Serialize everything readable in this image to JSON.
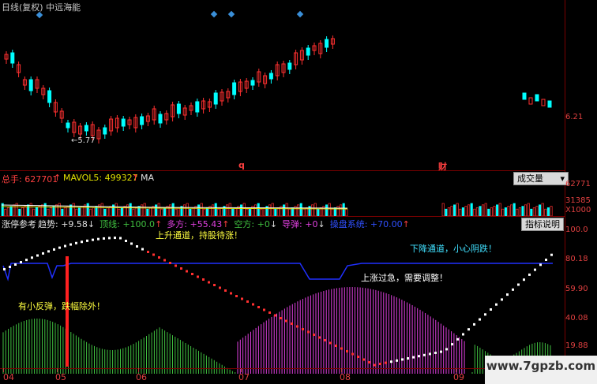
{
  "header": {
    "title": "日线(复权) 中远海能"
  },
  "price_panel": {
    "axis_label": "6.21",
    "low_marker": "5.77",
    "event_q": "q",
    "event_cai": "财"
  },
  "volume_panel": {
    "total_label": "总手: 627701",
    "mavol5_label": "MAVOL5: 499327",
    "ma_label": "MA",
    "dropdown_label": "成交量",
    "axis": [
      "62771",
      "31385",
      "X1000"
    ]
  },
  "indicator_panel": {
    "name": "涨停参考",
    "items": [
      {
        "label": "趋势: +9.58",
        "arrow": "↓",
        "color": "#e0e0e0"
      },
      {
        "label": "顶线: +100.0",
        "arrow": "↑",
        "color": "#40c040"
      },
      {
        "label": "多方: +55.43",
        "arrow": "↑",
        "color": "#e040e0"
      },
      {
        "label": "空方: +0",
        "arrow": "↓",
        "color": "#40c040"
      },
      {
        "label": "导弹: +0",
        "arrow": "↓",
        "color": "#e040e0"
      },
      {
        "label": "操盘系统: +70.00",
        "arrow": "↑",
        "color": "#3050ff"
      }
    ],
    "help_button": "指标说明",
    "axis": [
      "100.0",
      "80.18",
      "59.90",
      "40.08",
      "19.88"
    ],
    "notes": {
      "up_channel": "上升通道，持股待涨！",
      "down_channel": "下降通道，小心阴跌！",
      "overheat": "上涨过急，需要调整！",
      "rebound": "有小反弹，跌幅除外！"
    }
  },
  "x_axis": [
    "04",
    "05",
    "06",
    "07",
    "08",
    "09"
  ],
  "watermark": "www.7gpzb.com",
  "colors": {
    "up": "#ff3030",
    "down": "#00ffff",
    "grid": "#7a0000",
    "bull": "#e040e0",
    "bear": "#40c040"
  }
}
